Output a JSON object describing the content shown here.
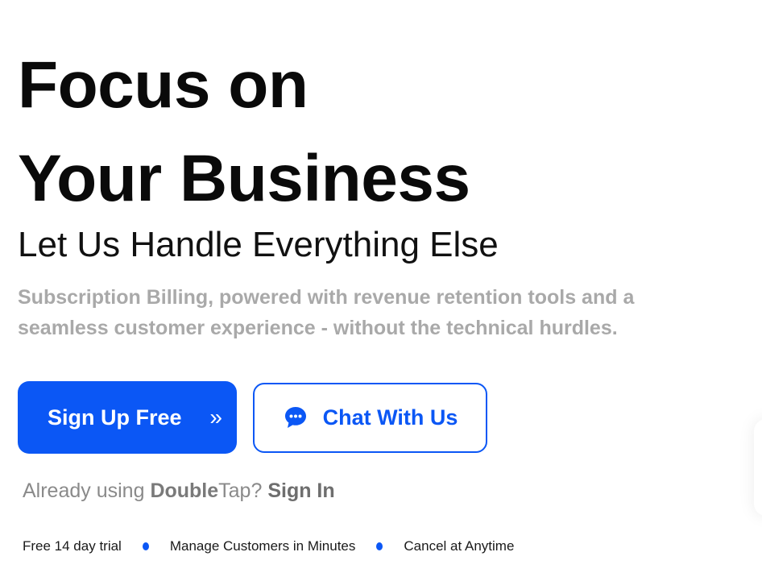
{
  "hero": {
    "headline_line1": "Focus on",
    "headline_line2": "Your Business",
    "subheading": "Let Us Handle Everything Else",
    "description": "Subscription Billing, powered with revenue retention tools and a seamless customer experience - without the technical hurdles."
  },
  "cta": {
    "signup_label": "Sign Up Free",
    "signup_chevron": "»",
    "signup_chevron_icon": "double-chevron-right-icon",
    "chat_label": "Chat With Us",
    "chat_icon": "chat-bubble-icon"
  },
  "signin": {
    "prefix": "Already using ",
    "brand_bold": "Double",
    "brand_regular": "Tap",
    "question": "? ",
    "link_label": "Sign In"
  },
  "features": [
    "Free 14 day trial",
    "Manage Customers in Minutes",
    "Cancel at Anytime"
  ],
  "colors": {
    "accent": "#0b57f5",
    "headline": "#0a0a0a",
    "muted_text": "#a9a9a9",
    "background": "#ffffff"
  }
}
